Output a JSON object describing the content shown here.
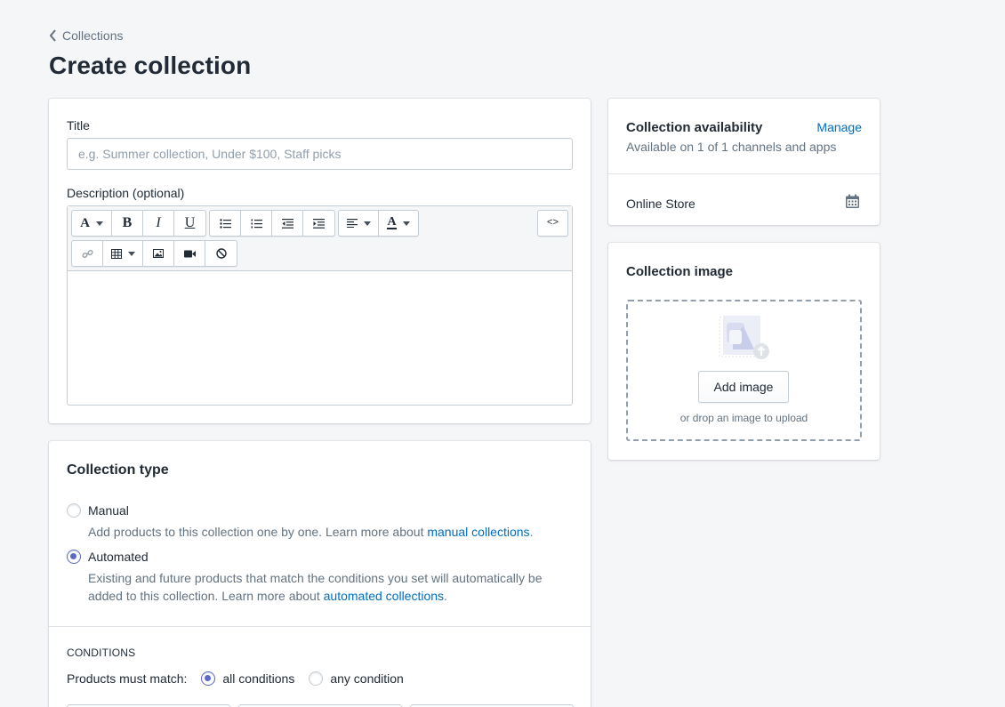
{
  "breadcrumb": {
    "label": "Collections"
  },
  "page": {
    "title": "Create collection"
  },
  "main_card": {
    "title_label": "Title",
    "title_placeholder": "e.g. Summer collection, Under $100, Staff picks",
    "title_value": "",
    "description_label": "Description (optional)",
    "toolbar": {
      "row1": [
        "text-format",
        "bold",
        "italic",
        "underline",
        "bullet-list",
        "numbered-list",
        "outdent",
        "indent",
        "align",
        "text-color",
        "show-html"
      ],
      "row2": [
        "link",
        "table",
        "image",
        "video",
        "clear-formatting"
      ]
    }
  },
  "collection_type": {
    "heading": "Collection type",
    "options": [
      {
        "label": "Manual",
        "checked": false,
        "help_prefix": "Add products to this collection one by one. Learn more about ",
        "help_link": "manual collections",
        "help_suffix": "."
      },
      {
        "label": "Automated",
        "checked": true,
        "help_prefix": "Existing and future products that match the conditions you set will automatically be added to this collection. Learn more about ",
        "help_link": "automated collections",
        "help_suffix": "."
      }
    ],
    "conditions_heading": "CONDITIONS",
    "match_label": "Products must match:",
    "match_options": [
      {
        "label": "all conditions",
        "checked": true
      },
      {
        "label": "any condition",
        "checked": false
      }
    ]
  },
  "availability": {
    "title": "Collection availability",
    "manage_label": "Manage",
    "subtitle": "Available on 1 of 1 channels and apps",
    "channel": "Online Store"
  },
  "image_card": {
    "title": "Collection image",
    "add_button": "Add image",
    "drop_hint": "or drop an image to upload"
  },
  "colors": {
    "accent": "#5c6ac4",
    "link": "#006fbb",
    "background": "#f4f6f8"
  }
}
